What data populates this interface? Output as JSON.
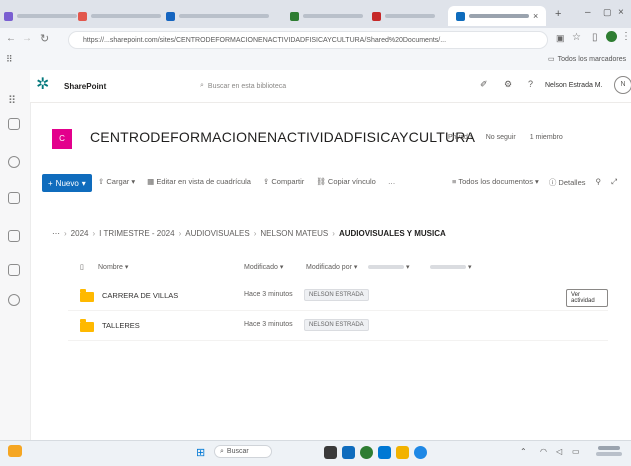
{
  "browser": {
    "tabs": [
      {
        "label": "",
        "color": "#7a5fd1"
      },
      {
        "label": "",
        "color": "#e2574c"
      },
      {
        "label": "",
        "color": "#2e7d32"
      },
      {
        "label": "",
        "color": "#1565c0"
      },
      {
        "label": "",
        "color": "#c62828"
      },
      {
        "label": "",
        "color": "#0f6cbd"
      }
    ],
    "url": "https://...sharepoint.com/sites/CENTRODEFORMACIONENACTIVIDADFISICAYCULTURA/Shared%20Documents/...",
    "bookmarks_label": "Todos los marcadores"
  },
  "sharepoint": {
    "app_name": "SharePoint",
    "search_placeholder": "Buscar en esta biblioteca",
    "user_label": "Nelson Estrada M."
  },
  "site": {
    "title": "CENTRODEFORMACIONENACTIVIDADFISICAYCULTURA",
    "header_actions": [
      "Privado",
      "No seguir",
      "1 miembro"
    ]
  },
  "commands": {
    "new_label": "Nuevo",
    "items": [
      "Cargar",
      "Editar en vista de cuadrícula",
      "Compartir",
      "Copiar vínculo"
    ],
    "more": "…",
    "view_label": "Todos los documentos",
    "details_label": "Detalles"
  },
  "breadcrumb": [
    "2024",
    "I TRIMESTRE - 2024",
    "AUDIOVISUALES",
    "NELSON MATEUS",
    "AUDIOVISUALES Y MUSICA"
  ],
  "table": {
    "columns": [
      "Nombre",
      "Modificado",
      "Modificado por",
      "",
      ""
    ],
    "rows": [
      {
        "name": "CARRERA DE VILLAS",
        "modified": "Hace 3 minutos",
        "modified_by": "NELSON ESTRADA",
        "action": "Ver actividad"
      },
      {
        "name": "TALLERES",
        "modified": "Hace 3 minutos",
        "modified_by": "NELSON ESTRADA",
        "action": ""
      }
    ]
  },
  "taskbar": {
    "weather": "",
    "search_label": "Buscar",
    "clock_time": "",
    "clock_date": ""
  },
  "colors": {
    "brand": "#0f6cbd",
    "site_logo": "#e3008c",
    "folder": "#ffb900"
  }
}
